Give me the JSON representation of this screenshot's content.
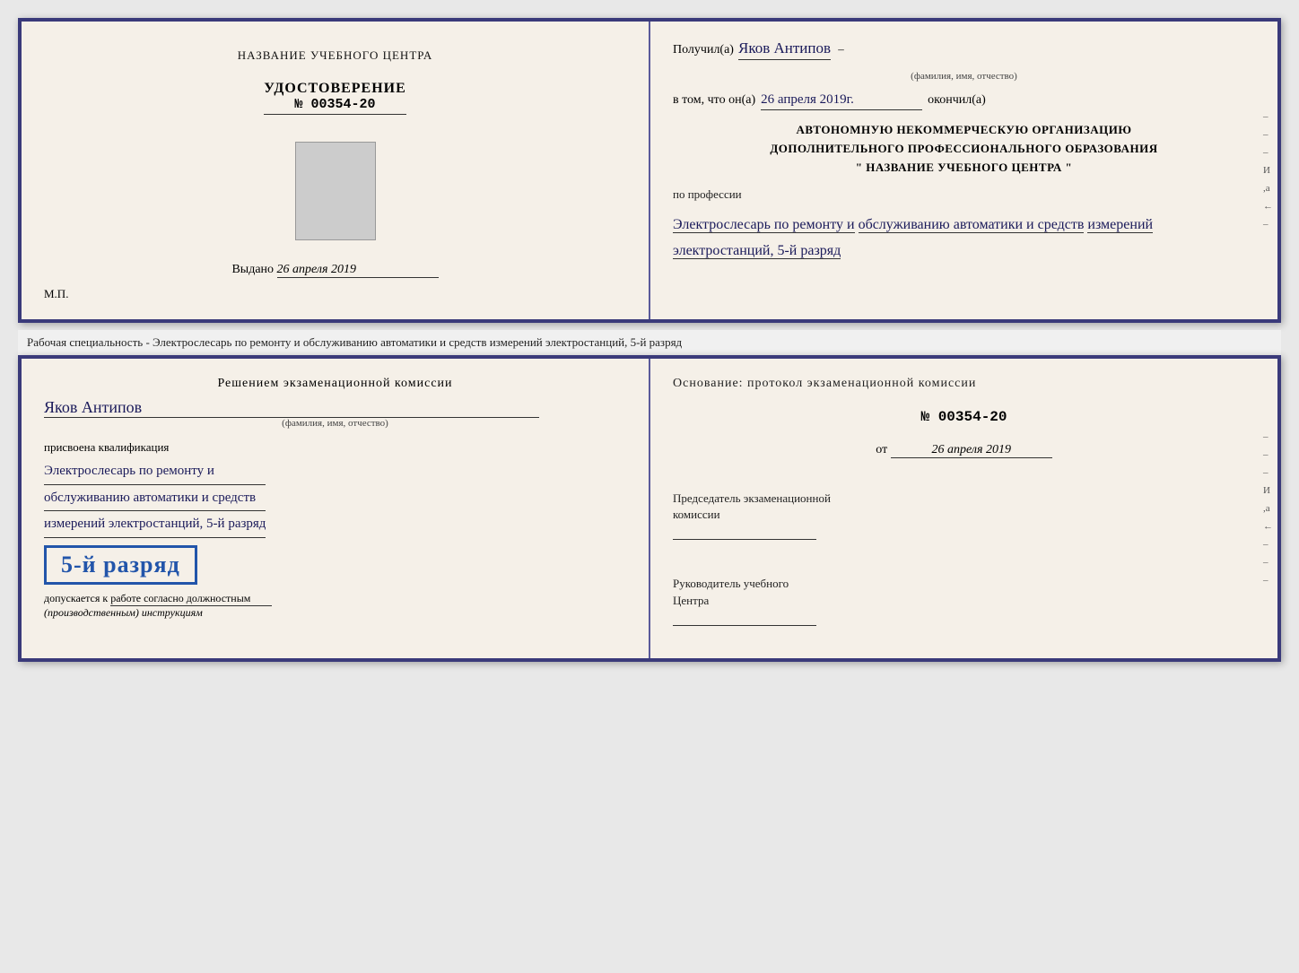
{
  "top_doc": {
    "left": {
      "center_title": "НАЗВАНИЕ УЧЕБНОГО ЦЕНТРА",
      "cert_title": "УДОСТОВЕРЕНИЕ",
      "cert_number": "№ 00354-20",
      "issued_label": "Выдано",
      "issued_date": "26 апреля 2019",
      "mp_label": "М.П."
    },
    "right": {
      "received_prefix": "Получил(а)",
      "received_name": "Яков Антипов",
      "fio_subtitle": "(фамилия, имя, отчество)",
      "date_prefix": "в том, что он(а)",
      "date_value": "26 апреля 2019г.",
      "date_suffix": "окончил(а)",
      "org_line1": "АВТОНОМНУЮ НЕКОММЕРЧЕСКУЮ ОРГАНИЗАЦИЮ",
      "org_line2": "ДОПОЛНИТЕЛЬНОГО ПРОФЕССИОНАЛЬНОГО ОБРАЗОВАНИЯ",
      "org_quote_open": "\"",
      "org_name": "НАЗВАНИЕ УЧЕБНОГО ЦЕНТРА",
      "org_quote_close": "\"",
      "profession_label": "по профессии",
      "profession_line1": "Электрослесарь по ремонту и",
      "profession_line2": "обслуживанию автоматики и средств",
      "profession_line3": "измерений электростанций, 5-й разряд"
    },
    "side_marks": [
      "-",
      "-",
      "-",
      "И",
      ",а",
      "←",
      "-"
    ]
  },
  "middle_text": "Рабочая специальность - Электрослесарь по ремонту и обслуживанию автоматики и средств измерений электростанций, 5-й разряд",
  "bottom_doc": {
    "left": {
      "decision_title": "Решением экзаменационной комиссии",
      "name": "Яков Антипов",
      "fio_subtitle": "(фамилия, имя, отчество)",
      "qualification_label": "присвоена квалификация",
      "qualification_line1": "Электрослесарь по ремонту и",
      "qualification_line2": "обслуживанию автоматики и средств",
      "qualification_line3": "измерений электростанций, 5-й разряд",
      "rank_badge": "5-й разряд",
      "allowed_label": "допускается к",
      "allowed_text": "работе согласно должностным",
      "allowed_italic": "(производственным) инструкциям"
    },
    "right": {
      "basis_label": "Основание: протокол экзаменационной комиссии",
      "protocol_number": "№ 00354-20",
      "date_prefix": "от",
      "date_value": "26 апреля 2019",
      "chairman_role_line1": "Председатель экзаменационной",
      "chairman_role_line2": "комиссии",
      "director_role_line1": "Руководитель учебного",
      "director_role_line2": "Центра"
    },
    "side_marks": [
      "-",
      "-",
      "-",
      "И",
      ",а",
      "←",
      "-",
      "-",
      "-"
    ]
  }
}
